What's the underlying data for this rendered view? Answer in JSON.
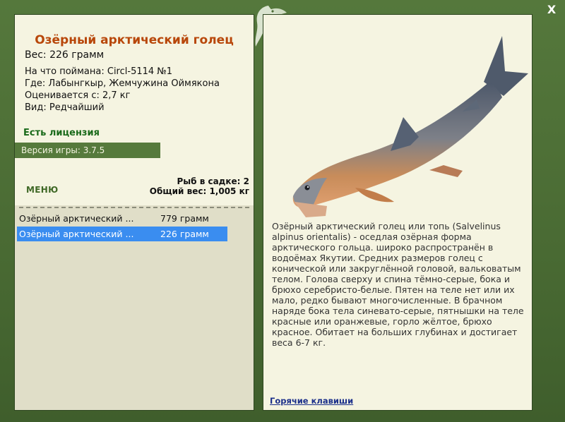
{
  "window": {
    "close_label": "X",
    "logo_icon": "fish-emblem-icon"
  },
  "fish": {
    "title": "Озёрный арктический голец",
    "weight_line": "Вес: 226 грамм",
    "caught_with": "На что поймана: Circl-5114 №1",
    "location": "Где: Лабынгкыр, Жемчужина Оймякона",
    "valued_from": "Оценивается с: 2,7 кг",
    "kind": "Вид: Редчайший",
    "image_icon": "arctic-char-fish-icon"
  },
  "license_text": "Есть лицензия",
  "version_text": "Версия игры: 3.7.5",
  "menu_label": "МЕНЮ",
  "keepnet": {
    "count_text": "Рыб в садке: 2",
    "total_text": "Общий вес: 1,005 кг"
  },
  "catch_list": [
    {
      "name": "Озёрный арктический ...",
      "weight": "779 грамм",
      "selected": false
    },
    {
      "name": "Озёрный арктический ...",
      "weight": "226 грамм",
      "selected": true
    }
  ],
  "description": "Озёрный арктический голец или топь (Salvelinus alpinus orientalis) - оседлая озёрная форма арктического гольца. широко распространён в водоёмах Якутии. Средних размеров голец с конической или закруглённой головой, вальковатым телом. Голова сверху и спина тёмно-серые, бока и брюхо серебристо-белые. Пятен на теле нет или их мало, редко бывают многочисленные. В брачном наряде бока тела синевато-серые, пятнышки на теле красные или оранжевые, горло жёлтое, брюхо красное. Обитает на больших глубинах и достигает веса 6-7 кг.",
  "hotkeys_label": "Горячие клавиши",
  "colors": {
    "title": "#b8470a",
    "selected_row": "#3a8df0",
    "version_bar": "#567a3c",
    "frame": "#4a6b34"
  }
}
